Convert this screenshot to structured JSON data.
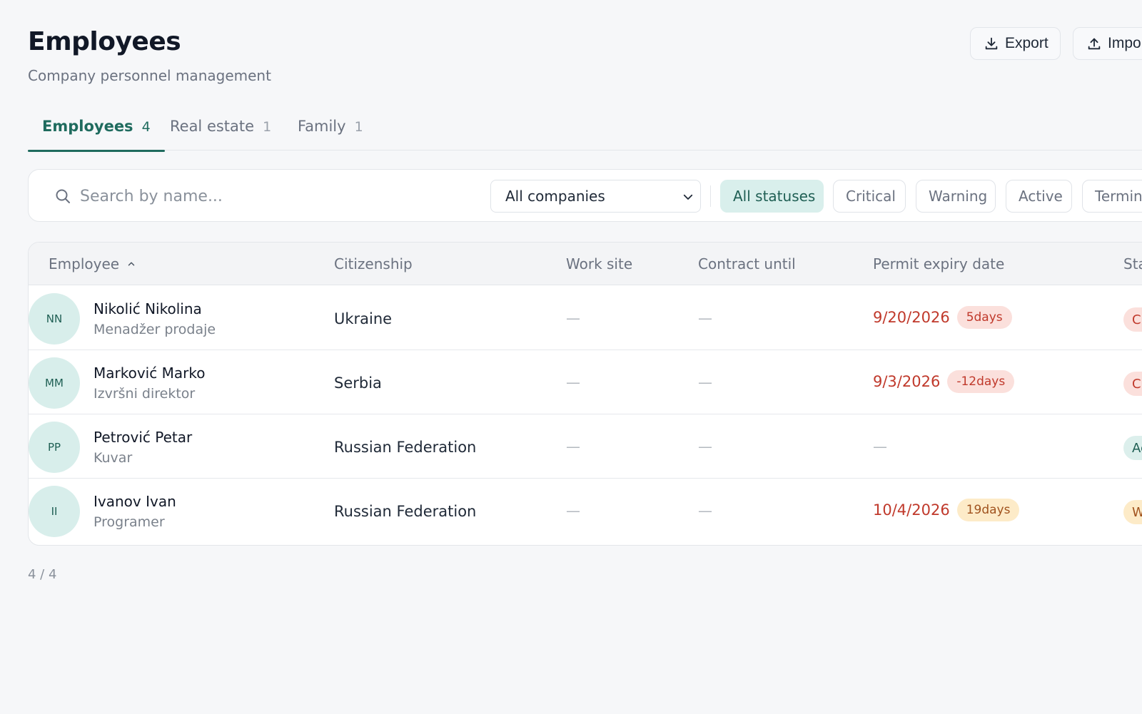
{
  "header": {
    "title": "Employees",
    "subtitle": "Company personnel management",
    "export_label": "Export",
    "import_label": "Impo"
  },
  "tabs": [
    {
      "label": "Employees",
      "count": "4",
      "active": true
    },
    {
      "label": "Real estate",
      "count": "1",
      "active": false
    },
    {
      "label": "Family",
      "count": "1",
      "active": false
    }
  ],
  "filters": {
    "search_placeholder": "Search by name...",
    "company_select": "All companies",
    "chips": [
      "All statuses",
      "Critical",
      "Warning",
      "Active",
      "Termina"
    ]
  },
  "table": {
    "columns": [
      "Employee",
      "Citizenship",
      "Work site",
      "Contract until",
      "Permit expiry date",
      "Sta"
    ],
    "rows": [
      {
        "initials": "NN",
        "name": "Nikolić Nikolina",
        "role": "Menadžer prodaje",
        "citizenship": "Ukraine",
        "work_site": "—",
        "contract_until": "—",
        "permit_date": "9/20/2026",
        "permit_days": "5days",
        "status": "C"
      },
      {
        "initials": "MM",
        "name": "Marković Marko",
        "role": "Izvršni direktor",
        "citizenship": "Serbia",
        "work_site": "—",
        "contract_until": "—",
        "permit_date": "9/3/2026",
        "permit_days": "-12days",
        "status": "C"
      },
      {
        "initials": "PP",
        "name": "Petrović Petar",
        "role": "Kuvar",
        "citizenship": "Russian Federation",
        "work_site": "—",
        "contract_until": "—",
        "permit_dash": "—",
        "status": "Ac"
      },
      {
        "initials": "II",
        "name": "Ivanov Ivan",
        "role": "Programer",
        "citizenship": "Russian Federation",
        "work_site": "—",
        "contract_until": "—",
        "permit_date": "10/4/2026",
        "permit_days": "19days",
        "status": "W"
      }
    ]
  },
  "pagination": {
    "label": "4 / 4"
  },
  "colors": {
    "accent": "#1f6b5e",
    "critical": "#c0392b",
    "warning": "#a0521d",
    "background": "#f6f7f9"
  },
  "icons": {
    "export": "download-icon",
    "import": "upload-icon",
    "search": "search-icon",
    "select": "chevron-down-icon",
    "sort": "chevron-up-icon"
  }
}
